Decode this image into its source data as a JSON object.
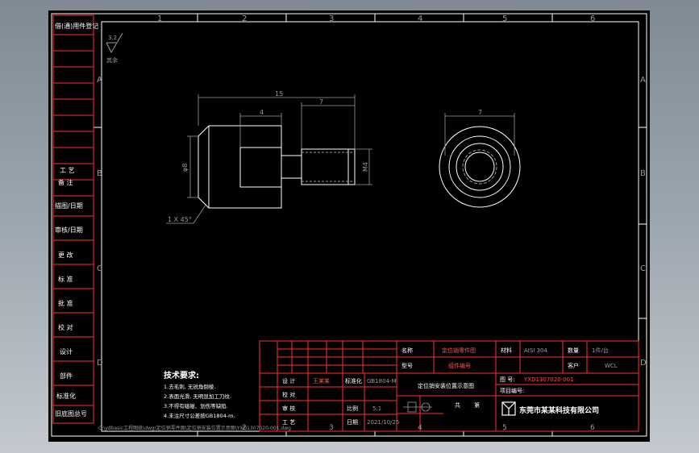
{
  "border": {
    "columns": [
      "1",
      "2",
      "3",
      "4",
      "5",
      "6"
    ],
    "rows": [
      "A",
      "B",
      "C",
      "D"
    ]
  },
  "left_strip": {
    "labels": [
      "借(通)用件登记",
      "工 艺",
      "备 注",
      "描图/日期",
      "审核/日期",
      "更 改",
      "标 准",
      "批 准",
      "校 对",
      "设计",
      "部件",
      "标准化",
      "旧底图总号"
    ]
  },
  "roughness": {
    "value": "3.2",
    "note": "其余"
  },
  "front_view": {
    "dims": {
      "overall": "15",
      "thread_len": "7",
      "body_len": "4",
      "dia": "φ8",
      "thread": "M4",
      "chamfer": "1 X 45°"
    }
  },
  "side_view": {
    "dim": "7"
  },
  "tech_requirements": {
    "title": "技术要求:",
    "lines": [
      "1.去毛刺, 无锐角倒棱.",
      "2.表面光滑, 无明显加工刀纹.",
      "3.不得有磕碰、划伤等缺陷.",
      "4.未注尺寸公差按GB1804-m."
    ]
  },
  "title_block": {
    "material_label": "材料",
    "material_value": "AISI 304",
    "qty_label": "数量",
    "qty_value": "1件/台",
    "drawing_no_label": "图 号:",
    "drawing_no_value": "YXD1307020-001",
    "customer_label": "客户",
    "customer_value": "WCL",
    "project_label": "项目编号:",
    "name_label": "名称",
    "name_value": "定位销零件图",
    "product_label": "型号",
    "product_value": "组件编号",
    "part_name": "定位销安装位置示意图",
    "sign_labels": [
      "设 计",
      "校 对",
      "审 核",
      "工 艺"
    ],
    "std_label": "标准化",
    "std_value": "GB1804-M",
    "scale_label": "比例",
    "scale_value": "5:1",
    "date_label": "日期",
    "date_value": "2021/10/25",
    "designer": "王某某",
    "sheet_a": "共",
    "sheet_b": "第",
    "company": "东莞市某某科技有限公司"
  },
  "file_path": "C:\\ydbasic工程图纸\\dwg\\定位销零件图\\定位销安装位置示意图\\YXD1307020-001.dwg"
}
